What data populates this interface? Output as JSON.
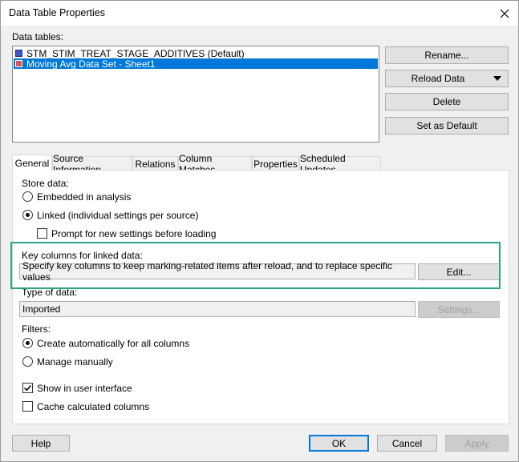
{
  "window": {
    "title": "Data Table Properties"
  },
  "data_tables": {
    "label": "Data tables:",
    "items": [
      {
        "label": "STM_STIM_TREAT_STAGE_ADDITIVES (Default)",
        "color": "#3a58c8",
        "selected": false
      },
      {
        "label": "Moving Avg Data Set - Sheet1",
        "color": "#e05252",
        "selected": true
      }
    ]
  },
  "side_buttons": {
    "rename": "Rename...",
    "reload": "Reload Data",
    "delete": "Delete",
    "set_default": "Set as Default"
  },
  "tabs": [
    {
      "label": "General",
      "active": true
    },
    {
      "label": "Source Information"
    },
    {
      "label": "Relations"
    },
    {
      "label": "Column Matches"
    },
    {
      "label": "Properties"
    },
    {
      "label": "Scheduled Updates"
    }
  ],
  "general": {
    "store_data_label": "Store data:",
    "embedded_label": "Embedded in analysis",
    "linked_label": "Linked (individual settings per source)",
    "prompt_label": "Prompt for new settings before loading",
    "key_columns_label": "Key columns for linked data:",
    "key_columns_value": "Specify key columns to keep marking-related items after reload, and to replace specific values",
    "edit_button": "Edit...",
    "type_label": "Type of data:",
    "type_value": "Imported",
    "settings_button": "Settings...",
    "filters_label": "Filters:",
    "create_auto_label": "Create automatically for all columns",
    "manage_manually_label": "Manage manually",
    "show_ui_label": "Show in user interface",
    "cache_label": "Cache calculated columns"
  },
  "footer": {
    "help": "Help",
    "ok": "OK",
    "cancel": "Cancel",
    "apply": "Apply"
  },
  "colors": {
    "accent": "#0078d7",
    "highlight": "#2aa58a"
  }
}
